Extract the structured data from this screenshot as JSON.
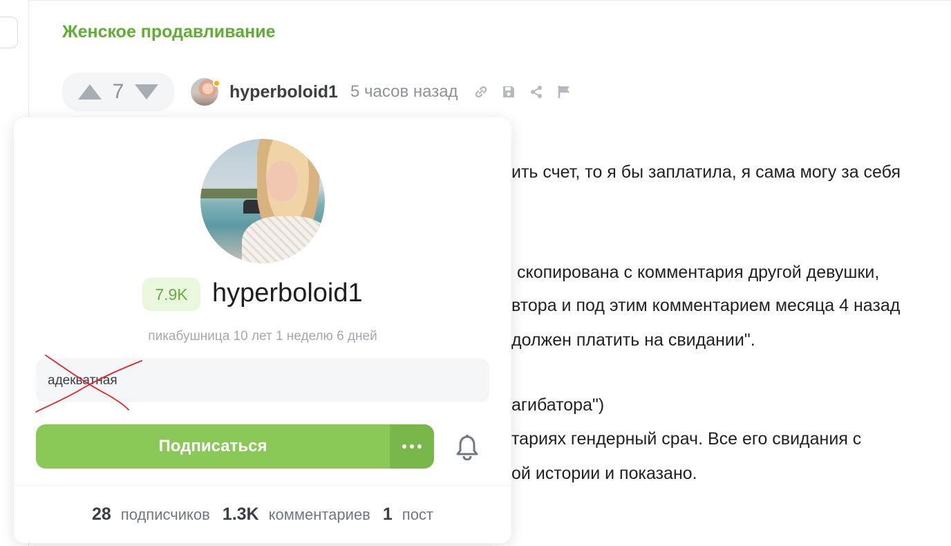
{
  "tag": {
    "title": "Женское продавливание"
  },
  "post": {
    "rating": "7",
    "author": "hyperboloid1",
    "time": "5 часов назад",
    "body_lines": [
      "ить счет, то я бы заплатила, я сама могу за себя",
      "скопирована с комментария другой девушки,",
      "втора и под этим комментарием месяца 4 назад",
      "должен платить на свидании\".",
      "агибатора\")",
      "тариях гендерный срач. Все его свидания с",
      "ой истории и показано."
    ]
  },
  "profile": {
    "rating_badge": "7.9K",
    "name": "hyperboloid1",
    "age": "пикабушница 10 лет 1 неделю 6 дней",
    "note": "адекватная",
    "subscribe_label": "Подписаться",
    "stats": {
      "subscribers_count": "28",
      "subscribers_label": "подписчиков",
      "comments_count": "1.3K",
      "comments_label": "комментариев",
      "posts_count": "1",
      "posts_label": "пост"
    }
  },
  "colors": {
    "accent_green": "#8ac858",
    "tag_green": "#5fad32",
    "online_dot": "#f2b400",
    "scribble_red": "#e0242b"
  },
  "icons": [
    "arrow-up-icon",
    "arrow-down-icon",
    "link-icon",
    "save-icon",
    "share-icon",
    "flag-icon",
    "more-dots-icon",
    "bell-icon"
  ]
}
